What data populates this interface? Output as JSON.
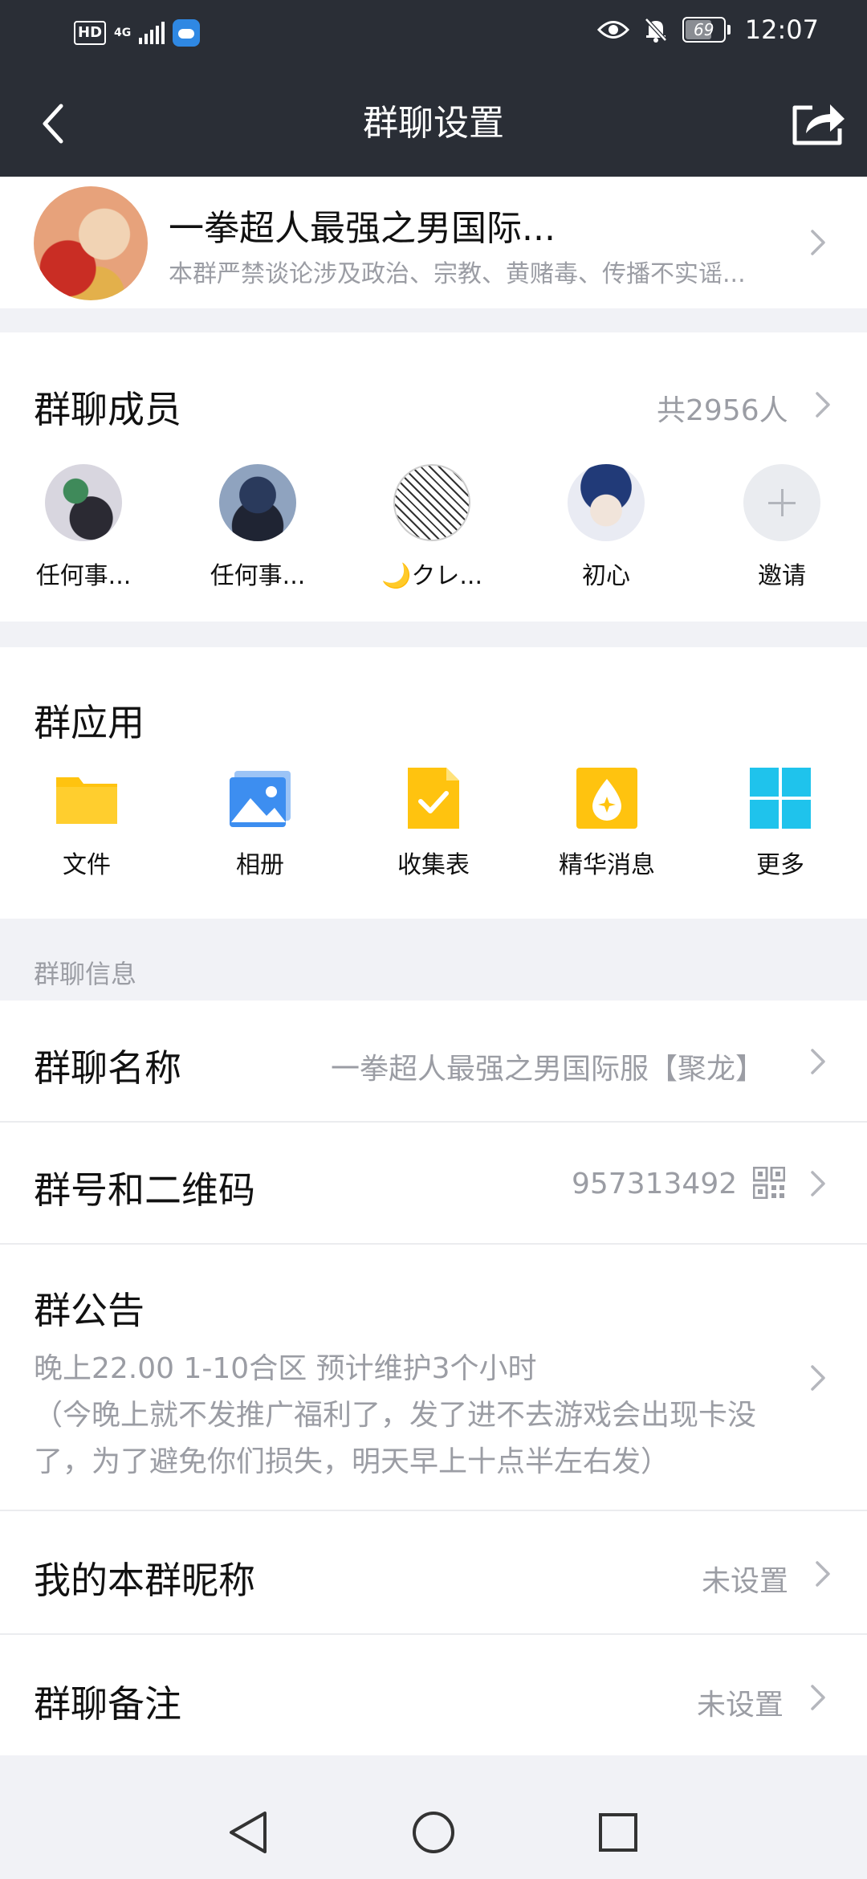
{
  "status_bar": {
    "hd": "HD",
    "network": "4G",
    "battery": "69",
    "battery_level_pct": 69,
    "time": "12:07"
  },
  "nav": {
    "title": "群聊设置",
    "back_icon": "chevron-left-icon",
    "share_icon": "share-icon"
  },
  "group": {
    "name": "一拳超人最强之男国际...",
    "notice": "本群严禁谈论涉及政治、宗教、黄赌毒、传播不实谣..."
  },
  "members": {
    "title": "群聊成员",
    "count": "共2956人",
    "list": [
      {
        "name": "任何事..."
      },
      {
        "name": "任何事..."
      },
      {
        "name": "🌙クレ..."
      },
      {
        "name": "初心"
      }
    ],
    "invite_label": "邀请"
  },
  "apps": {
    "title": "群应用",
    "items": [
      {
        "label": "文件",
        "icon": "folder-icon",
        "color": "#ffc30f"
      },
      {
        "label": "相册",
        "icon": "photo-album-icon",
        "color": "#3d8ef0"
      },
      {
        "label": "收集表",
        "icon": "form-check-icon",
        "color": "#ffc30f"
      },
      {
        "label": "精华消息",
        "icon": "star-drop-icon",
        "color": "#ffc30f"
      },
      {
        "label": "更多",
        "icon": "grid-icon",
        "color": "#1fc3ec"
      }
    ]
  },
  "info": {
    "section_label": "群聊信息",
    "name_row": {
      "title": "群聊名称",
      "value": "一拳超人最强之男国际服【聚龙】"
    },
    "id_row": {
      "title": "群号和二维码",
      "value": "957313492"
    },
    "announcement": {
      "title": "群公告",
      "line1": "晚上22.00 1-10合区 预计维护3个小时",
      "line2": "（今晚上就不发推广福利了，发了进不去游戏会出现卡没",
      "line3": "了，为了避免你们损失，明天早上十点半左右发）"
    },
    "nickname_row": {
      "title": "我的本群昵称",
      "value": "未设置"
    },
    "remark_row": {
      "title": "群聊备注",
      "value": "未设置"
    }
  },
  "system_nav": [
    "back",
    "home",
    "recents"
  ]
}
